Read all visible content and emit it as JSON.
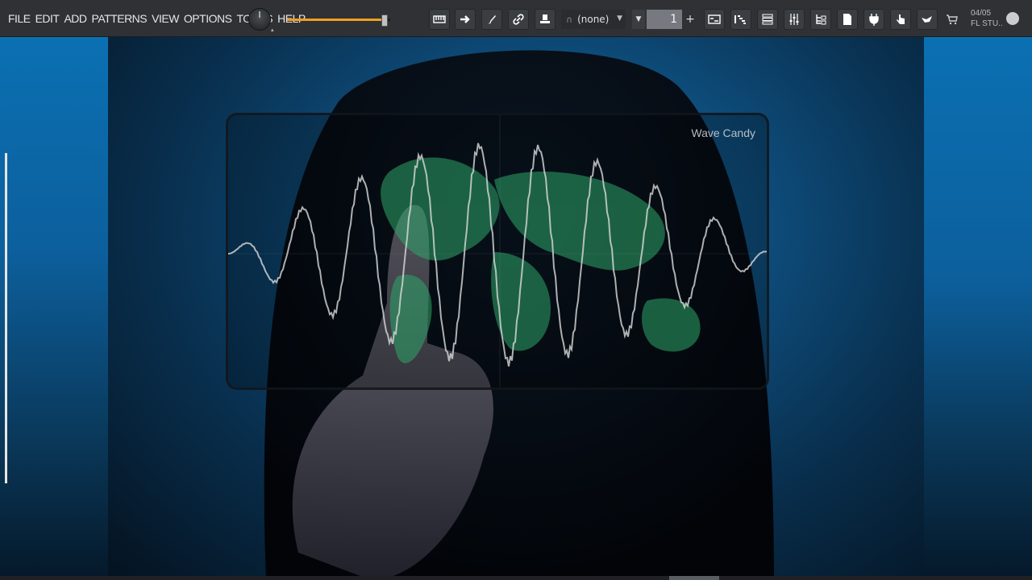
{
  "menu": {
    "items": [
      "FILE",
      "EDIT",
      "ADD",
      "PATTERNS",
      "VIEW",
      "OPTIONS",
      "TOOLS",
      "HELP"
    ]
  },
  "master_volume_fraction": 0.94,
  "snap_selector": {
    "value": "(none)"
  },
  "pattern_selector": {
    "value": "1",
    "add_label": "+"
  },
  "hint_bar": {
    "line1": "04/05",
    "line2": "FL STU.."
  },
  "wave_candy": {
    "title": "Wave Candy"
  },
  "icons": {
    "toolbar": [
      "typing-keyboard-icon",
      "step-arrow-icon",
      "paint-brush-icon",
      "link-icon",
      "stamp-icon",
      "magnet-icon",
      "pattern-caret-icon",
      "playlist-icon",
      "piano-roll-icon",
      "channel-rack-icon",
      "mixer-icon",
      "browser-icon",
      "plugin-database-icon",
      "plugin-icon",
      "touch-controller-icon",
      "bird-icon",
      "cart-icon",
      "globe-icon"
    ]
  },
  "colors": {
    "toolbar": "#2f3135",
    "accent_orange": "#f0a020",
    "scope_green": "#2ea66a",
    "wave": "#d9d9d9",
    "bg_blue": "#0d5c96"
  }
}
